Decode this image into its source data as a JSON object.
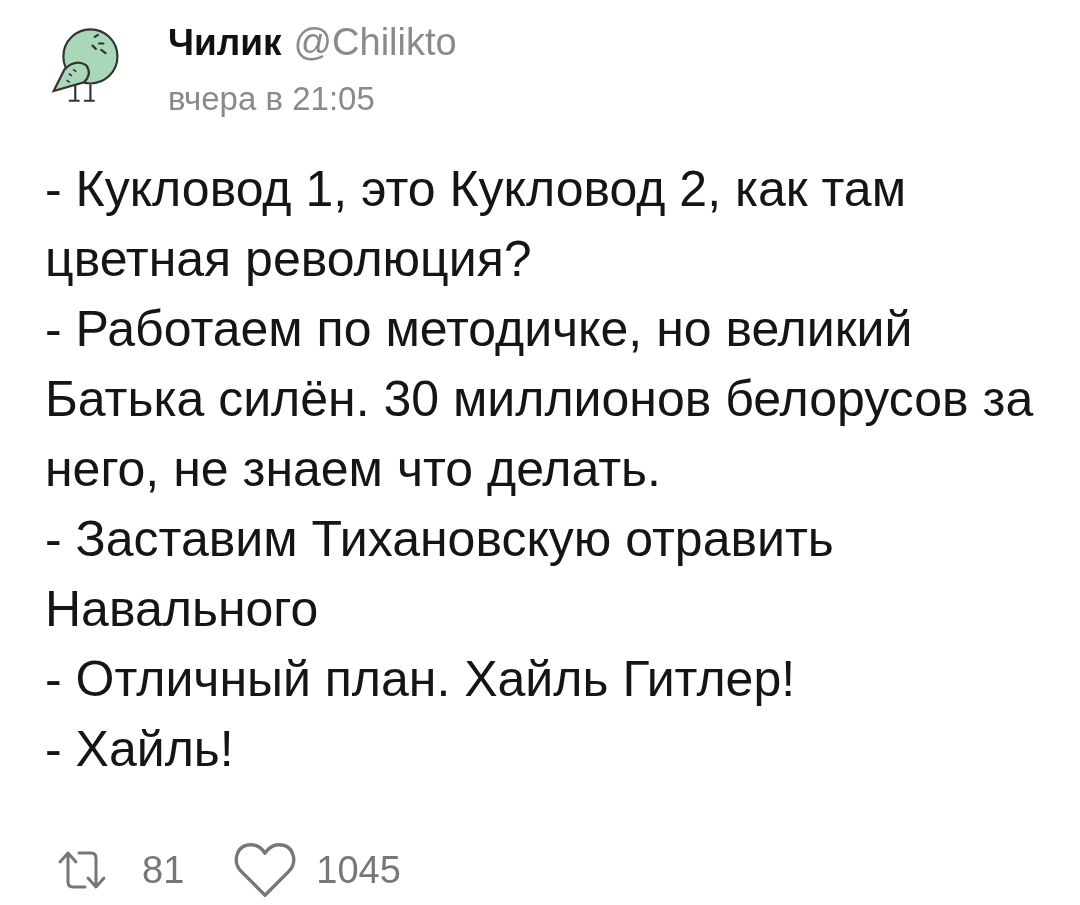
{
  "post": {
    "author": {
      "name": "Чилик",
      "handle": "@Chilikto"
    },
    "time": "вчера в 21:05",
    "paragraphs": [
      "- Кукловод 1, это Кукловод 2, как там цветная революция?",
      "- Работаем по методичке, но великий Батька силён. 30 миллионов белорусов за него, не знаем что делать.",
      "- Заставим Тихановскую отравить Навального",
      "- Отличный план. Хайль Гитлер!",
      "- Хайль!"
    ],
    "actions": [
      {
        "kind": "repost",
        "count": "81"
      },
      {
        "kind": "like",
        "count": "1045"
      }
    ]
  }
}
